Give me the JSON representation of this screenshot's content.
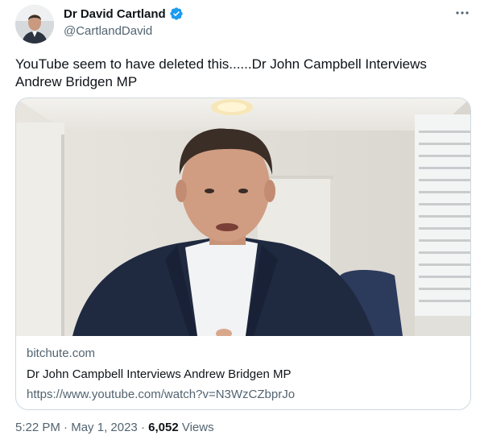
{
  "author": {
    "name": "Dr David Cartland",
    "handle": "@CartlandDavid",
    "verified_color": "#1d9bf0"
  },
  "tweet": {
    "text": "YouTube seem to have deleted this......Dr John Campbell Interviews Andrew Bridgen MP"
  },
  "card": {
    "domain": "bitchute.com",
    "title": "Dr John Campbell Interviews Andrew Bridgen MP",
    "description": "https://www.youtube.com/watch?v=N3WzCZbprJo"
  },
  "meta": {
    "time": "5:22 PM",
    "separator1": " · ",
    "date": "May 1, 2023",
    "separator2": " · ",
    "views_count": "6,052",
    "views_label": " Views"
  },
  "icons": {
    "more": "more-horizontal-icon",
    "verified": "verified-badge-icon"
  }
}
